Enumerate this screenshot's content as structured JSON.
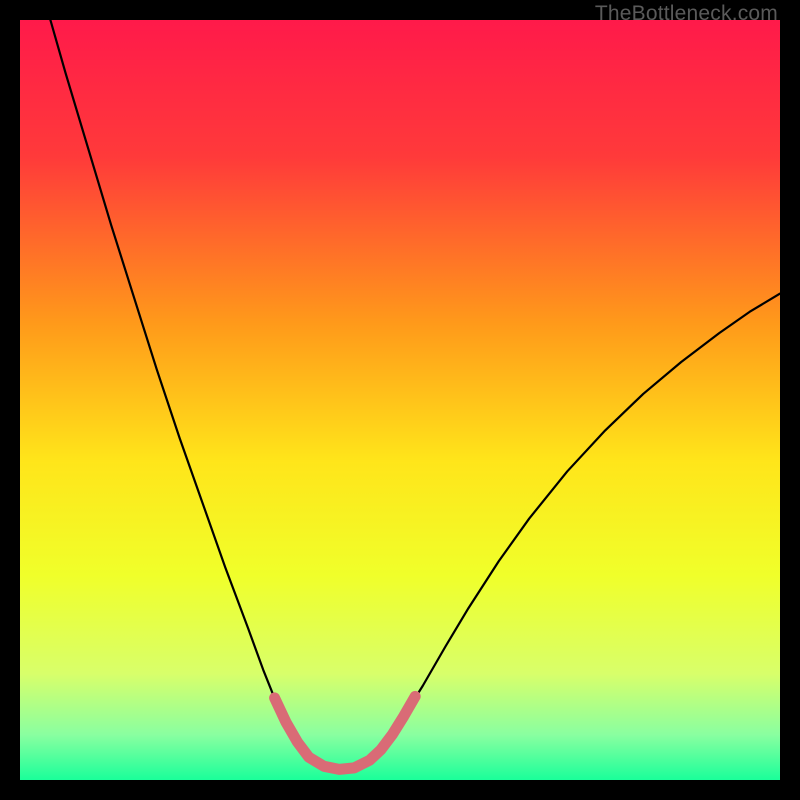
{
  "watermark": "TheBottleneck.com",
  "chart_data": {
    "type": "line",
    "title": "",
    "xlabel": "",
    "ylabel": "",
    "xlim": [
      0,
      100
    ],
    "ylim": [
      0,
      100
    ],
    "gradient_stops": [
      {
        "offset": 0,
        "color": "#ff1a4a"
      },
      {
        "offset": 18,
        "color": "#ff3a3a"
      },
      {
        "offset": 40,
        "color": "#ff9a1a"
      },
      {
        "offset": 58,
        "color": "#ffe51a"
      },
      {
        "offset": 73,
        "color": "#f0ff2a"
      },
      {
        "offset": 86,
        "color": "#d8ff6a"
      },
      {
        "offset": 94,
        "color": "#8affa0"
      },
      {
        "offset": 100,
        "color": "#1aff9a"
      }
    ],
    "series": [
      {
        "name": "bottleneck-curve",
        "color": "#000000",
        "width": 2.2,
        "points": [
          {
            "x": 4.0,
            "y": 100.0
          },
          {
            "x": 6.0,
            "y": 93.0
          },
          {
            "x": 9.0,
            "y": 83.0
          },
          {
            "x": 12.0,
            "y": 73.0
          },
          {
            "x": 15.0,
            "y": 63.5
          },
          {
            "x": 18.0,
            "y": 54.0
          },
          {
            "x": 21.0,
            "y": 45.0
          },
          {
            "x": 24.0,
            "y": 36.5
          },
          {
            "x": 27.0,
            "y": 28.0
          },
          {
            "x": 30.0,
            "y": 20.0
          },
          {
            "x": 32.0,
            "y": 14.5
          },
          {
            "x": 34.0,
            "y": 9.5
          },
          {
            "x": 36.0,
            "y": 5.5
          },
          {
            "x": 38.0,
            "y": 3.0
          },
          {
            "x": 40.0,
            "y": 1.8
          },
          {
            "x": 42.0,
            "y": 1.4
          },
          {
            "x": 44.0,
            "y": 1.6
          },
          {
            "x": 46.0,
            "y": 2.6
          },
          {
            "x": 48.0,
            "y": 4.6
          },
          {
            "x": 50.0,
            "y": 7.6
          },
          {
            "x": 53.0,
            "y": 12.4
          },
          {
            "x": 56.0,
            "y": 17.6
          },
          {
            "x": 59.0,
            "y": 22.6
          },
          {
            "x": 63.0,
            "y": 28.8
          },
          {
            "x": 67.0,
            "y": 34.4
          },
          {
            "x": 72.0,
            "y": 40.6
          },
          {
            "x": 77.0,
            "y": 46.0
          },
          {
            "x": 82.0,
            "y": 50.8
          },
          {
            "x": 87.0,
            "y": 55.0
          },
          {
            "x": 92.0,
            "y": 58.8
          },
          {
            "x": 96.0,
            "y": 61.6
          },
          {
            "x": 100.0,
            "y": 64.0
          }
        ]
      },
      {
        "name": "optimal-zone-highlight",
        "color": "#d96b76",
        "width": 11,
        "linecap": "round",
        "points": [
          {
            "x": 33.5,
            "y": 10.8
          },
          {
            "x": 35.0,
            "y": 7.6
          },
          {
            "x": 36.5,
            "y": 5.0
          },
          {
            "x": 38.0,
            "y": 3.0
          },
          {
            "x": 40.0,
            "y": 1.8
          },
          {
            "x": 42.0,
            "y": 1.4
          },
          {
            "x": 44.0,
            "y": 1.6
          },
          {
            "x": 46.0,
            "y": 2.6
          },
          {
            "x": 47.5,
            "y": 4.0
          },
          {
            "x": 49.0,
            "y": 6.0
          },
          {
            "x": 50.5,
            "y": 8.4
          },
          {
            "x": 52.0,
            "y": 11.0
          }
        ]
      }
    ]
  }
}
